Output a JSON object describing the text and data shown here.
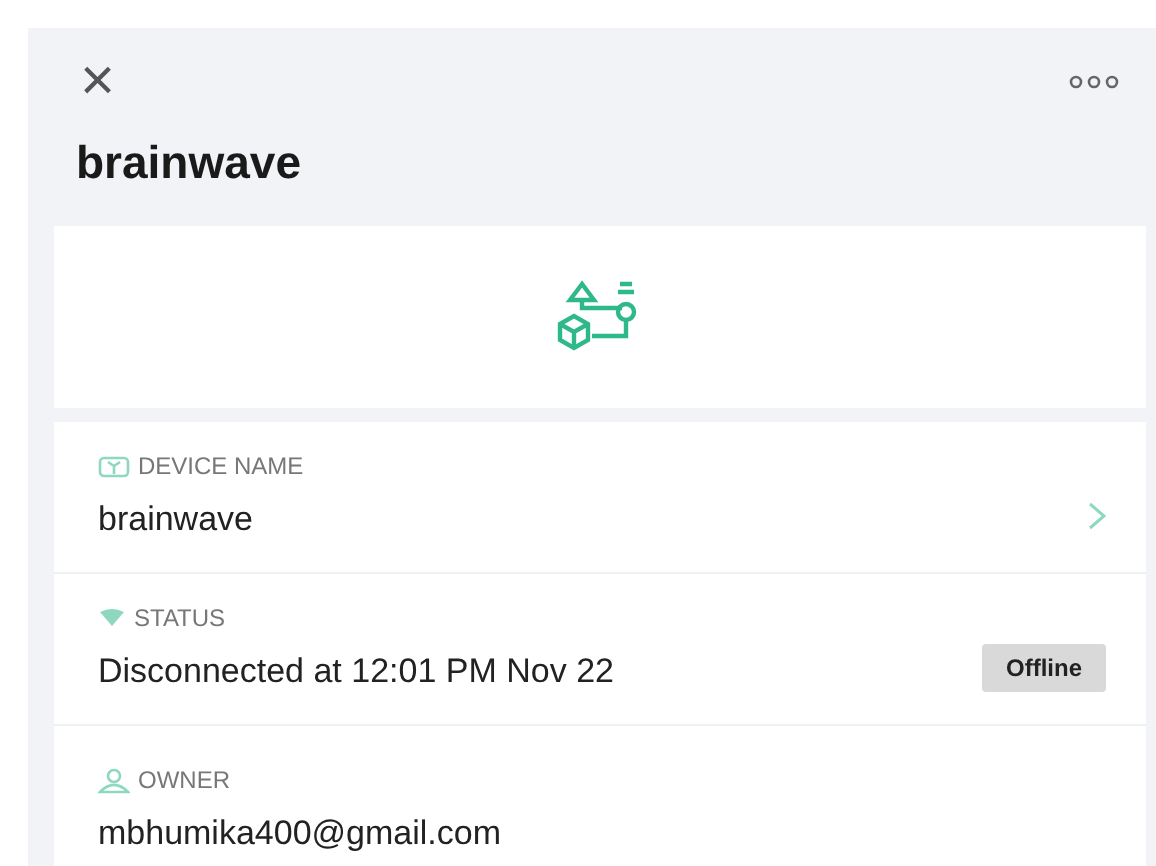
{
  "header": {
    "close": "×",
    "title": "brainwave"
  },
  "fields": [
    {
      "kind": "link",
      "label": "DEVICE NAME",
      "value": "brainwave"
    },
    {
      "kind": "badge",
      "label": "STATUS",
      "value": "Disconnected at 12:01 PM Nov 22",
      "badge": "Offline"
    },
    {
      "kind": "plain",
      "label": "OWNER",
      "value": "mbhumika400@gmail.com"
    }
  ]
}
